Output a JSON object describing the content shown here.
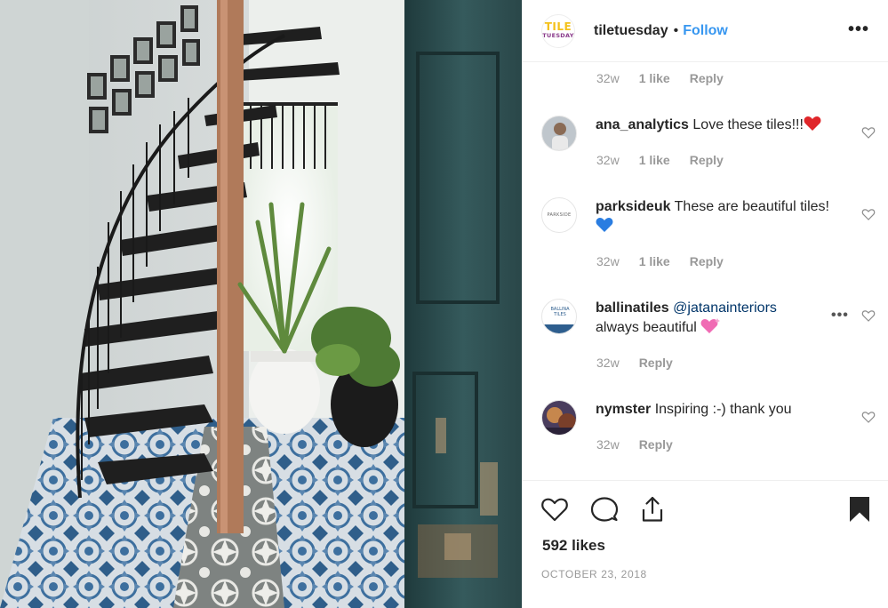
{
  "post": {
    "account": {
      "username": "tiletuesday",
      "separator": "•",
      "follow_label": "Follow",
      "logo_line1": "TILE",
      "logo_line2": "TUESDAY",
      "more_icon": "more-horizontal-icon"
    },
    "comments": [
      {
        "time": "32w",
        "likes": "1 like",
        "reply": "Reply"
      },
      {
        "username": "ana_analytics",
        "text": "Love these tiles!!!",
        "emoji": "red-heart",
        "time": "32w",
        "likes": "1 like",
        "reply": "Reply"
      },
      {
        "username": "parksideuk",
        "text": "These are beautiful tiles!",
        "emoji": "blue-heart",
        "avatar_text": "PARKSIDE",
        "time": "32w",
        "likes": "1 like",
        "reply": "Reply"
      },
      {
        "username": "ballinatiles",
        "mention": "@jatanainteriors",
        "text": "always beautiful",
        "emoji": "sparkling-heart",
        "avatar_text_1": "BALLINA",
        "avatar_text_2": "TILES",
        "more": "•••",
        "time": "32w",
        "reply": "Reply"
      },
      {
        "username": "nymster",
        "text": "Inspiring :-) thank you",
        "time": "32w",
        "reply": "Reply"
      }
    ],
    "actions": {
      "like_icon": "heart-outline-icon",
      "comment_icon": "comment-bubble-icon",
      "share_icon": "share-upload-icon",
      "save_icon": "bookmark-filled-icon"
    },
    "likes_count": "592 likes",
    "date": "OCTOBER 23, 2018"
  },
  "colors": {
    "follow": "#3897f0",
    "mention": "#003569",
    "muted": "#999999",
    "text": "#262626",
    "logo_yellow": "#f4c11a",
    "logo_purple": "#8a3a8a"
  }
}
